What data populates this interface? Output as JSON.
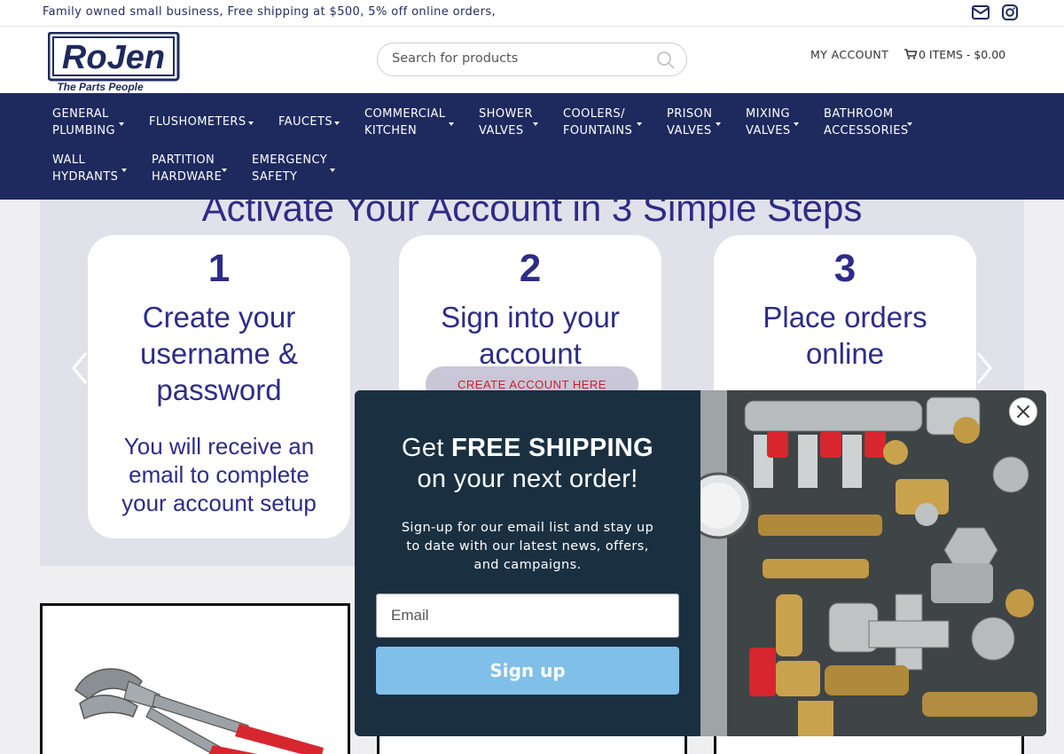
{
  "topbar": {
    "announcement": "Family owned small business, Free shipping at $500, 5% off online orders,",
    "icons": [
      "envelope-icon",
      "instagram-icon"
    ]
  },
  "header": {
    "logo_text": "RoJen",
    "logo_tagline": "The Parts People",
    "search_placeholder": "Search for products",
    "my_account": "MY ACCOUNT",
    "cart": "0 ITEMS - $0.00"
  },
  "nav": {
    "items": [
      {
        "line1": "GENERAL",
        "line2": "PLUMBING"
      },
      {
        "line1": "FLUSHOMETERS",
        "line2": ""
      },
      {
        "line1": "FAUCETS",
        "line2": ""
      },
      {
        "line1": "COMMERCIAL",
        "line2": "KITCHEN"
      },
      {
        "line1": "SHOWER",
        "line2": "VALVES"
      },
      {
        "line1": "COOLERS/",
        "line2": "FOUNTAINS"
      },
      {
        "line1": "PRISON",
        "line2": "VALVES"
      },
      {
        "line1": "MIXING",
        "line2": "VALVES"
      },
      {
        "line1": "BATHROOM",
        "line2": "ACCESSORIES"
      },
      {
        "line1": "WALL",
        "line2": "HYDRANTS"
      },
      {
        "line1": "PARTITION",
        "line2": "HARDWARE"
      },
      {
        "line1": "EMERGENCY",
        "line2": "SAFETY"
      }
    ]
  },
  "slider": {
    "heading": "Activate Your Account in 3 Simple Steps",
    "steps": [
      {
        "num": "1",
        "title1": "Create your",
        "title2": "username &",
        "title3": "password",
        "sub1": "You will receive an",
        "sub2": "email to complete",
        "sub3": "your account setup"
      },
      {
        "num": "2",
        "title1": "Sign into your",
        "title2": "account",
        "button": "CREATE ACCOUNT HERE"
      },
      {
        "num": "3",
        "title1": "Place orders",
        "title2": "online"
      }
    ]
  },
  "popup": {
    "heading_prefix": "Get ",
    "heading_bold": "FREE SHIPPING",
    "heading_line2": "on your next order!",
    "description": "Sign-up for our email list and stay up to date with our latest news, offers, and campaigns.",
    "email_placeholder": "Email",
    "signup_label": "Sign up"
  },
  "colors": {
    "nav_bg": "#1e2a5e",
    "brand_purple": "#2d2c87",
    "popup_bg": "#1a3041",
    "signup_btn": "#7fbfe8",
    "create_btn_text": "#d11c2c"
  }
}
